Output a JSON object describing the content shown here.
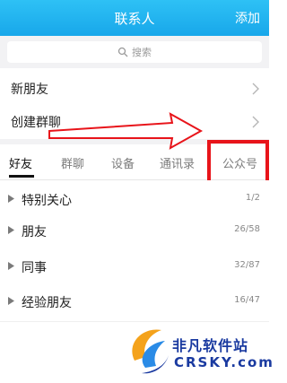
{
  "header": {
    "title": "联系人",
    "add_label": "添加"
  },
  "search": {
    "placeholder": "搜索",
    "icon": "search-icon"
  },
  "menu_rows": [
    {
      "label": "新朋友"
    },
    {
      "label": "创建群聊"
    }
  ],
  "tabs": [
    {
      "label": "好友",
      "active": true
    },
    {
      "label": "群聊"
    },
    {
      "label": "设备"
    },
    {
      "label": "通讯录"
    },
    {
      "label": "公众号"
    }
  ],
  "groups": [
    {
      "name": "特别关心",
      "count": "1/2"
    },
    {
      "name": "朋友",
      "count": "26/58"
    },
    {
      "name": "同事",
      "count": "32/87"
    },
    {
      "name": "经验朋友",
      "count": "16/47"
    }
  ],
  "watermark": {
    "title": "非凡软件站",
    "sub": "CRSKY.com"
  },
  "colors": {
    "header": "#1aa9ec",
    "highlight": "#e8141a",
    "arrow": "#e8141a"
  }
}
